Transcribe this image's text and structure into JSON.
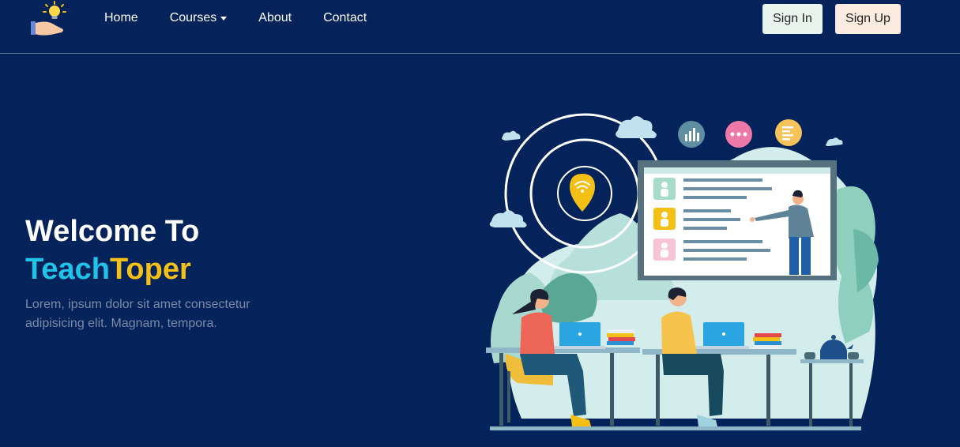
{
  "nav": {
    "links": [
      {
        "label": "Home"
      },
      {
        "label": "Courses",
        "has_dropdown": true
      },
      {
        "label": "About"
      },
      {
        "label": "Contact"
      }
    ],
    "sign_in": "Sign In",
    "sign_up": "Sign Up"
  },
  "hero": {
    "title_line1": "Welcome To",
    "brand_part1": "Teach",
    "brand_part2": "Toper",
    "description": "Lorem, ipsum dolor sit amet consectetur adipisicing elit. Magnam, tempora."
  },
  "colors": {
    "background": "#03235a",
    "brand_teach": "#22c3e9",
    "brand_toper": "#f5c016",
    "sign_in_bg": "#eaf4ee",
    "sign_up_bg": "#fcebe1"
  },
  "icons": {
    "logo": "lightbulb-hand-icon"
  }
}
